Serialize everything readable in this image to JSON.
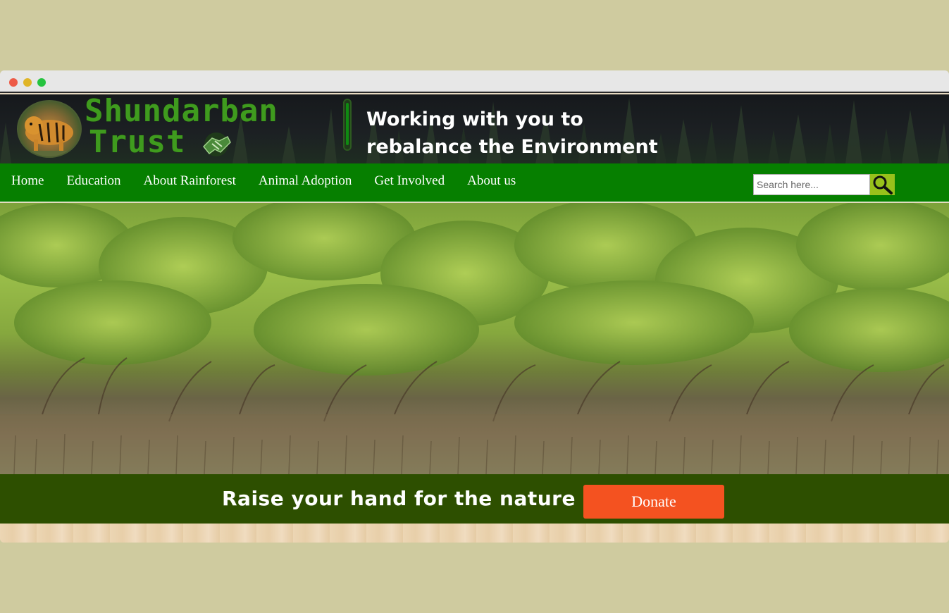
{
  "window": {
    "controls": [
      "close",
      "minimize",
      "maximize"
    ]
  },
  "header": {
    "brand_line1": "Shundarban",
    "brand_line2": "Trust",
    "tagline_line1": "Working with you to",
    "tagline_line2": "rebalance the Environment",
    "logo_icon": "tiger-logo-icon",
    "hands_icon": "handshake-icon"
  },
  "nav": {
    "items": [
      {
        "label": "Home"
      },
      {
        "label": "Education"
      },
      {
        "label": "About Rainforest"
      },
      {
        "label": "Animal Adoption"
      },
      {
        "label": "Get Involved"
      },
      {
        "label": "About us"
      }
    ],
    "search": {
      "placeholder": "Search here...",
      "value": "",
      "icon": "search-icon"
    }
  },
  "cta": {
    "text": "Raise your hand for the nature :)",
    "button_label": "Donate"
  },
  "colors": {
    "page_bg": "#cfcb9f",
    "nav_bg": "#067f00",
    "cta_bg": "#2d4f00",
    "donate_bg": "#f45220",
    "brand_green": "#3f9b1e"
  }
}
